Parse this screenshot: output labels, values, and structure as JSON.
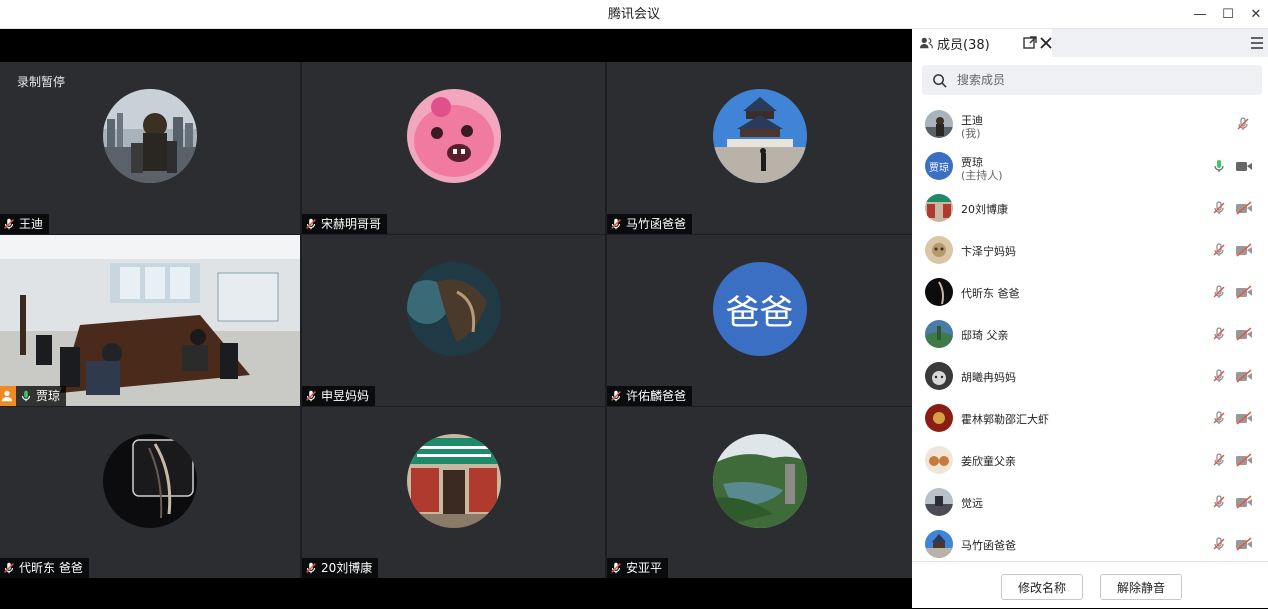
{
  "window": {
    "title": "腾讯会议",
    "minimize": "—",
    "maximize": "☐",
    "close": "✕"
  },
  "recording_status": "录制暂停",
  "tiles": [
    {
      "name": "王迪",
      "mic": "muted",
      "avatar_kind": "city-photo"
    },
    {
      "name": "宋赫明哥哥",
      "mic": "muted",
      "avatar_kind": "pink-creature"
    },
    {
      "name": "马竹函爸爸",
      "mic": "muted",
      "avatar_kind": "temple-photo"
    },
    {
      "name": "贾琼",
      "mic": "on",
      "host": true,
      "avatar_kind": "meeting-room-video",
      "active": true
    },
    {
      "name": "申昱妈妈",
      "mic": "muted",
      "avatar_kind": "hair-photo"
    },
    {
      "name": "许佑麟爸爸",
      "mic": "muted",
      "avatar_kind": "text-avatar",
      "avatar_text": "爸爸",
      "avatar_color": "#3b6fc4"
    },
    {
      "name": "代昕东 爸爸",
      "mic": "muted",
      "avatar_kind": "dark-photo"
    },
    {
      "name": "20刘博康",
      "mic": "muted",
      "avatar_kind": "storefront-photo"
    },
    {
      "name": "安亚平",
      "mic": "muted",
      "avatar_kind": "lake-photo"
    }
  ],
  "sidebar": {
    "title": "成员(38)",
    "search_placeholder": "搜索成员",
    "members": [
      {
        "name": "王迪",
        "role": "(我)",
        "mic": "muted",
        "cam": "none",
        "avatar_color": "#6b7a86"
      },
      {
        "name": "贾琼",
        "role": "(主持人)",
        "mic": "on",
        "cam": "on",
        "avatar_text": "贾琼",
        "avatar_color": "#3b6fc4"
      },
      {
        "name": "20刘博康",
        "role": "",
        "mic": "muted",
        "cam": "off",
        "avatar_color": "#7a6a4e"
      },
      {
        "name": "卞泽宁妈妈",
        "role": "",
        "mic": "muted",
        "cam": "off",
        "avatar_color": "#b89a6a"
      },
      {
        "name": "代昕东 爸爸",
        "role": "",
        "mic": "muted",
        "cam": "off",
        "avatar_color": "#1b1b1b"
      },
      {
        "name": "邸琦 父亲",
        "role": "",
        "mic": "muted",
        "cam": "off",
        "avatar_color": "#3f7a48"
      },
      {
        "name": "胡曦冉妈妈",
        "role": "",
        "mic": "muted",
        "cam": "off",
        "avatar_color": "#4a4a4a"
      },
      {
        "name": "霍林郭勒邵汇大虾",
        "role": "",
        "mic": "muted",
        "cam": "off",
        "avatar_color": "#8a1e12"
      },
      {
        "name": "姜欣童父亲",
        "role": "",
        "mic": "muted",
        "cam": "off",
        "avatar_color": "#c97a3a"
      },
      {
        "name": "觉远",
        "role": "",
        "mic": "muted",
        "cam": "off",
        "avatar_color": "#707880"
      },
      {
        "name": "马竹函爸爸",
        "role": "",
        "mic": "muted",
        "cam": "off",
        "avatar_color": "#6a8cb0"
      }
    ],
    "rename_button": "修改名称",
    "unmute_button": "解除静音"
  },
  "colors": {
    "active_border": "#3ec764",
    "mic_on": "#3ec764",
    "muted_red": "#e05a4b",
    "host_badge": "#f08a24"
  }
}
